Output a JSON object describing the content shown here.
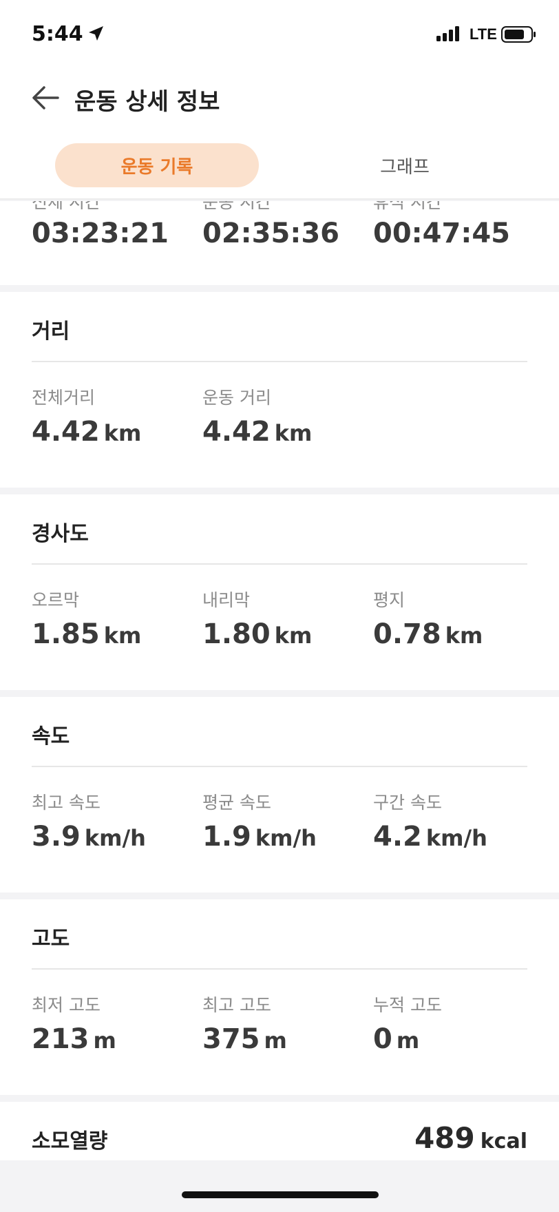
{
  "status_bar": {
    "time": "5:44",
    "network": "LTE"
  },
  "header": {
    "title": "운동 상세 정보"
  },
  "tabs": [
    {
      "label": "운동 기록",
      "active": true
    },
    {
      "label": "그래프",
      "active": false
    }
  ],
  "sections": {
    "time": {
      "stats": [
        {
          "label": "전체 시간",
          "value": "03:23:21"
        },
        {
          "label": "운동 시간",
          "value": "02:35:36"
        },
        {
          "label": "휴식 시간",
          "value": "00:47:45"
        }
      ]
    },
    "distance": {
      "title": "거리",
      "stats": [
        {
          "label": "전체거리",
          "value": "4.42",
          "unit": "km"
        },
        {
          "label": "운동 거리",
          "value": "4.42",
          "unit": "km"
        }
      ]
    },
    "slope": {
      "title": "경사도",
      "stats": [
        {
          "label": "오르막",
          "value": "1.85",
          "unit": "km"
        },
        {
          "label": "내리막",
          "value": "1.80",
          "unit": "km"
        },
        {
          "label": "평지",
          "value": "0.78",
          "unit": "km"
        }
      ]
    },
    "speed": {
      "title": "속도",
      "stats": [
        {
          "label": "최고 속도",
          "value": "3.9",
          "unit": "km/h"
        },
        {
          "label": "평균 속도",
          "value": "1.9",
          "unit": "km/h"
        },
        {
          "label": "구간 속도",
          "value": "4.2",
          "unit": "km/h"
        }
      ]
    },
    "altitude": {
      "title": "고도",
      "stats": [
        {
          "label": "최저 고도",
          "value": "213",
          "unit": "m"
        },
        {
          "label": "최고 고도",
          "value": "375",
          "unit": "m"
        },
        {
          "label": "누적 고도",
          "value": "0",
          "unit": "m"
        }
      ]
    },
    "calories": {
      "label": "소모열량",
      "value": "489",
      "unit": "kcal"
    }
  },
  "colors": {
    "accent": "#ea7a2a",
    "accent_bg": "#fbe1cd"
  }
}
